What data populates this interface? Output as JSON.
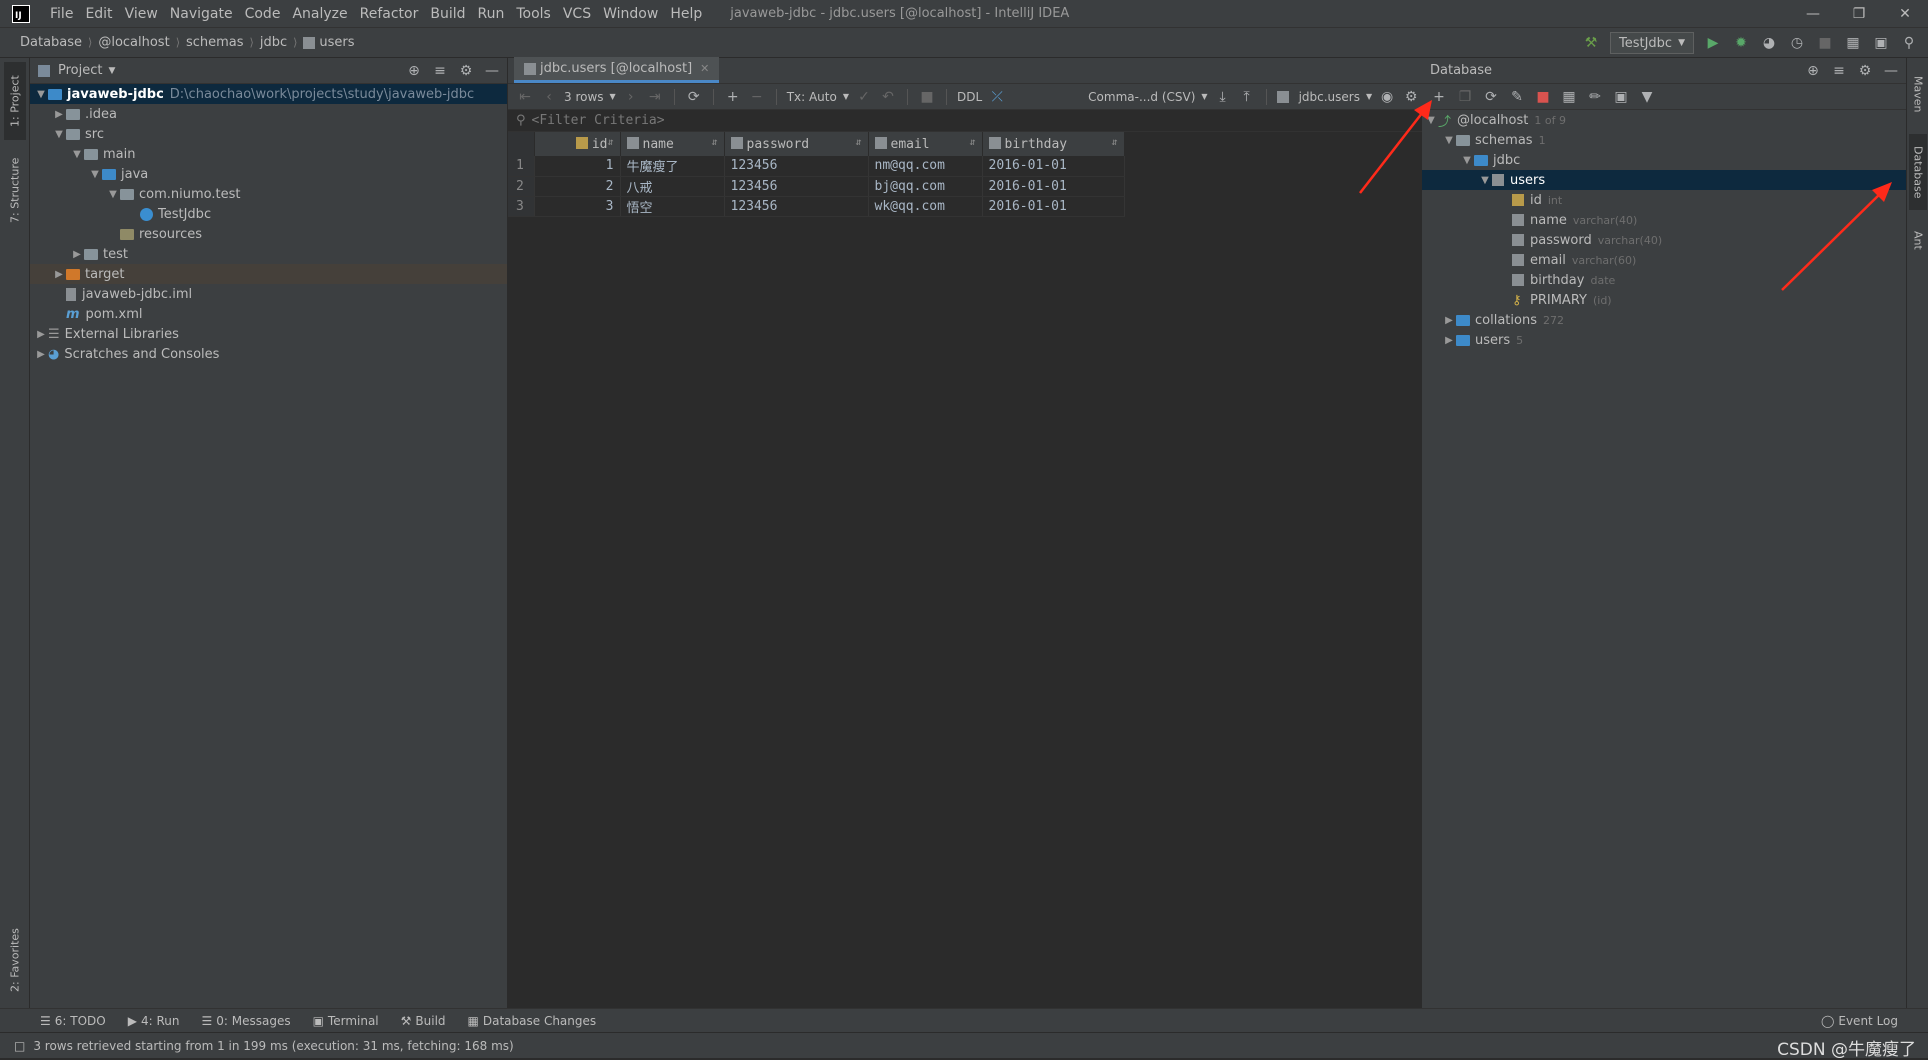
{
  "titlebar": {
    "menu": [
      "File",
      "Edit",
      "View",
      "Navigate",
      "Code",
      "Analyze",
      "Refactor",
      "Build",
      "Run",
      "Tools",
      "VCS",
      "Window",
      "Help"
    ],
    "window_title": "javaweb-jdbc - jdbc.users [@localhost] - IntelliJ IDEA"
  },
  "breadcrumb": [
    "Database",
    "@localhost",
    "schemas",
    "jdbc",
    "users"
  ],
  "run_config": "TestJdbc",
  "left_tabs": [
    "1: Project",
    "7: Structure",
    "2: Favorites"
  ],
  "right_tabs": [
    "Maven",
    "Database",
    "Ant"
  ],
  "project": {
    "title": "Project",
    "items": [
      {
        "label": "javaweb-jdbc",
        "extra": "D:\\chaochao\\work\\projects\\study\\javaweb-jdbc"
      },
      {
        "label": ".idea"
      },
      {
        "label": "src"
      },
      {
        "label": "main"
      },
      {
        "label": "java"
      },
      {
        "label": "com.niumo.test"
      },
      {
        "label": "TestJdbc"
      },
      {
        "label": "resources"
      },
      {
        "label": "test"
      },
      {
        "label": "target"
      },
      {
        "label": "javaweb-jdbc.iml"
      },
      {
        "label": "pom.xml"
      },
      {
        "label": "External Libraries"
      },
      {
        "label": "Scratches and Consoles"
      }
    ]
  },
  "editor": {
    "tab": "jdbc.users [@localhost]",
    "rows_label": "3 rows",
    "tx_label": "Tx: Auto",
    "ddl": "DDL",
    "export_format": "Comma-...d (CSV)",
    "table_ref": "jdbc.users",
    "filter_placeholder": "<Filter Criteria>",
    "columns": [
      "id",
      "name",
      "password",
      "email",
      "birthday"
    ],
    "rows": [
      {
        "n": "1",
        "cells": [
          "1",
          "牛魔瘦了",
          "123456",
          "nm@qq.com",
          "2016-01-01"
        ]
      },
      {
        "n": "2",
        "cells": [
          "2",
          "八戒",
          "123456",
          "bj@qq.com",
          "2016-01-01"
        ]
      },
      {
        "n": "3",
        "cells": [
          "3",
          "悟空",
          "123456",
          "wk@qq.com",
          "2016-01-01"
        ]
      }
    ]
  },
  "database": {
    "title": "Database",
    "host": {
      "label": "@localhost",
      "badge": "1 of 9"
    },
    "schemas": {
      "label": "schemas",
      "badge": "1"
    },
    "jdbc": "jdbc",
    "users_table": "users",
    "columns": [
      {
        "name": "id",
        "type": "int"
      },
      {
        "name": "name",
        "type": "varchar(40)"
      },
      {
        "name": "password",
        "type": "varchar(40)"
      },
      {
        "name": "email",
        "type": "varchar(60)"
      },
      {
        "name": "birthday",
        "type": "date"
      },
      {
        "name": "PRIMARY",
        "type": "(id)"
      }
    ],
    "collations": {
      "label": "collations",
      "badge": "272"
    },
    "users_group": {
      "label": "users",
      "badge": "5"
    }
  },
  "bottom_tabs": [
    "6: TODO",
    "4: Run",
    "0: Messages",
    "Terminal",
    "Build",
    "Database Changes"
  ],
  "event_log": "Event Log",
  "status": "3 rows retrieved starting from 1 in 199 ms (execution: 31 ms, fetching: 168 ms)",
  "watermark": "CSDN @牛魔瘦了",
  "accent": "#4a88c7",
  "annotation_color": "#ff2a1a"
}
